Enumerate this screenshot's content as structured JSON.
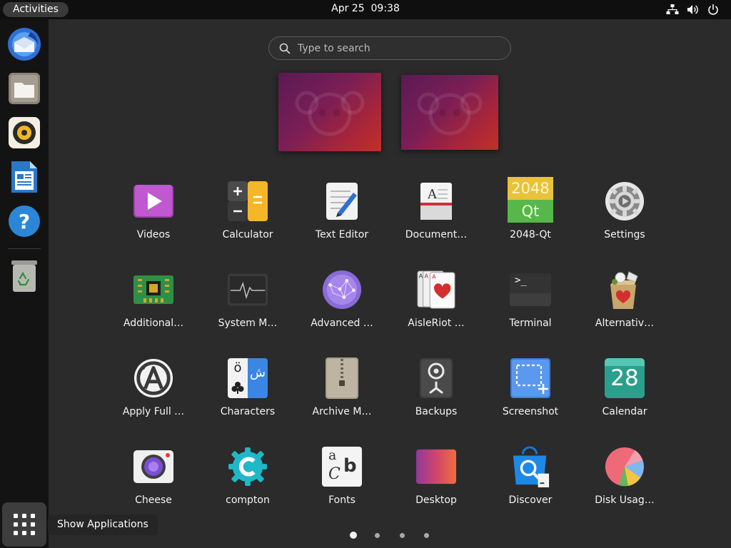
{
  "topbar": {
    "activities": "Activities",
    "date": "Apr 25",
    "time": "09:38",
    "tray_icons": [
      "network-icon",
      "volume-icon",
      "power-icon"
    ]
  },
  "dock": {
    "items": [
      {
        "name": "Thunderbird Mail",
        "icon": "thunderbird-icon"
      },
      {
        "name": "Files",
        "icon": "files-icon"
      },
      {
        "name": "Rhythmbox",
        "icon": "rhythmbox-icon"
      },
      {
        "name": "LibreOffice Writer",
        "icon": "writer-icon"
      },
      {
        "name": "Help",
        "icon": "help-icon"
      },
      {
        "name": "Trash",
        "icon": "trash-icon"
      }
    ],
    "show_apps_tooltip": "Show Applications"
  },
  "search": {
    "placeholder": "Type to search",
    "value": ""
  },
  "apps": [
    {
      "label": "Videos",
      "icon": "videos-icon"
    },
    {
      "label": "Calculator",
      "icon": "calculator-icon"
    },
    {
      "label": "Text Editor",
      "icon": "text-editor-icon"
    },
    {
      "label": "Document…",
      "icon": "document-viewer-icon"
    },
    {
      "label": "2048-Qt",
      "icon": "game-2048-icon",
      "icon_text_top": "2048",
      "icon_text_bottom": "Qt"
    },
    {
      "label": "Settings",
      "icon": "settings-icon"
    },
    {
      "label": "Additional…",
      "icon": "additional-drivers-icon"
    },
    {
      "label": "System M…",
      "icon": "system-monitor-icon"
    },
    {
      "label": "Advanced …",
      "icon": "advanced-network-icon"
    },
    {
      "label": "AisleRiot …",
      "icon": "aisleriot-cards-icon"
    },
    {
      "label": "Terminal",
      "icon": "terminal-icon",
      "icon_text": ">_"
    },
    {
      "label": "Alternativ…",
      "icon": "alternatives-icon"
    },
    {
      "label": "Apply Full …",
      "icon": "apply-full-upgrade-icon"
    },
    {
      "label": "Characters",
      "icon": "characters-icon",
      "icon_text_left": "ö",
      "icon_text_right": "ش"
    },
    {
      "label": "Archive M…",
      "icon": "archive-manager-icon"
    },
    {
      "label": "Backups",
      "icon": "backups-icon"
    },
    {
      "label": "Screenshot",
      "icon": "screenshot-icon"
    },
    {
      "label": "Calendar",
      "icon": "calendar-icon",
      "icon_text": "28"
    },
    {
      "label": "Cheese",
      "icon": "cheese-icon"
    },
    {
      "label": "compton",
      "icon": "compton-icon"
    },
    {
      "label": "Fonts",
      "icon": "fonts-icon",
      "icon_text_a": "a",
      "icon_text_b": "b",
      "icon_text_c": "C"
    },
    {
      "label": "Desktop",
      "icon": "desktop-icon"
    },
    {
      "label": "Discover",
      "icon": "discover-icon"
    },
    {
      "label": "Disk Usag…",
      "icon": "disk-usage-icon"
    }
  ],
  "pagination": {
    "pages": 4,
    "current": 1
  }
}
